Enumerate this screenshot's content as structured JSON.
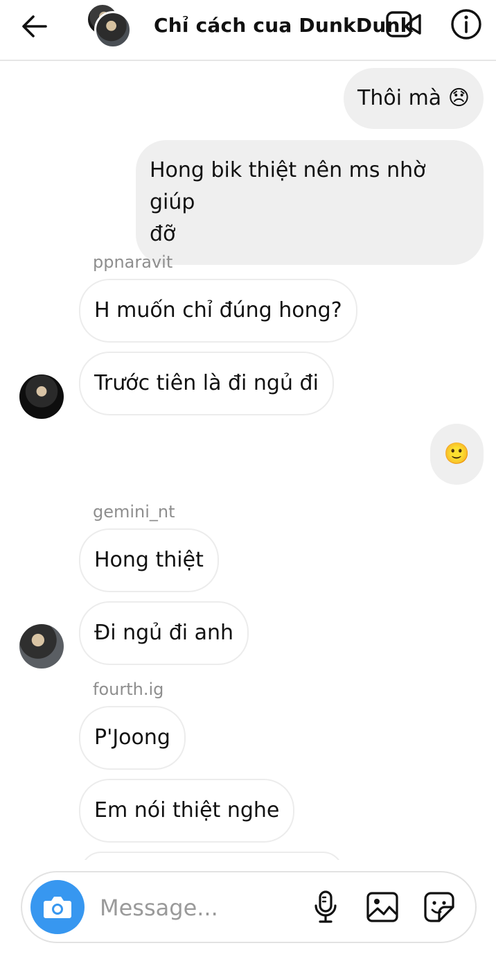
{
  "header": {
    "title": "Chỉ cách cua DunkDunk"
  },
  "messages": {
    "m1": "Thôi mà 😞",
    "m2_line1": "Hong bik thiệt nên ms nhờ giúp",
    "m2_line2": "đỡ",
    "sender1": "ppnaravit",
    "m3": "H muốn chỉ đúng hong?",
    "m4": "Trước tiên là đi ngủ đi",
    "m5": "🙂",
    "sender2": "gemini_nt",
    "m6": "Hong thiệt",
    "m7": "Đi ngủ đi anh",
    "sender3": "fourth.ig",
    "m8": "P'Joong",
    "m9": "Em nói thiệt nghe"
  },
  "composer": {
    "placeholder": "Message..."
  },
  "colors": {
    "accent": "#3797f0",
    "outgoing_bubble": "#efefef",
    "incoming_border": "#ececec",
    "sender_text": "#8e8e8e"
  },
  "icons": {
    "back": "arrow-left-icon",
    "video": "video-camera-icon",
    "info": "info-icon",
    "camera": "camera-icon",
    "mic": "microphone-icon",
    "gallery": "image-icon",
    "sticker": "sticker-icon"
  }
}
